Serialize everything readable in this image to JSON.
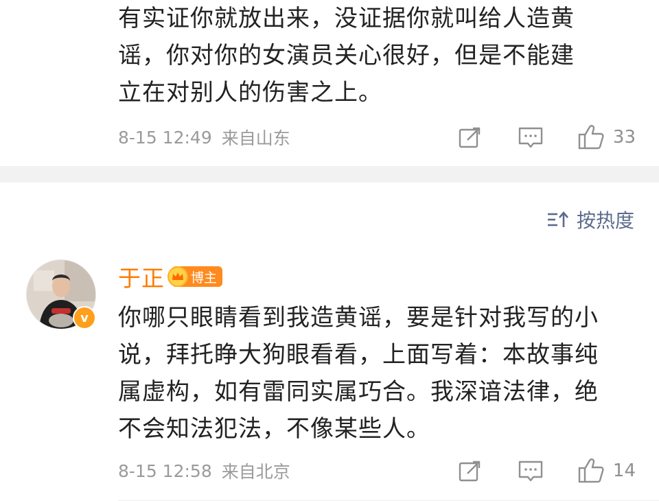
{
  "comments": [
    {
      "text_lines": [
        "有实证你就放出来，没证据你就叫给人造黄",
        "谣，你对你的女演员关心很好，但是不能建",
        "立在对别人的伤害之上。"
      ],
      "time": "8-15 12:49",
      "location": "来自山东",
      "likes": "33"
    },
    {
      "author": "于正",
      "author_badge": "博主",
      "verified_mark": "v",
      "text_lines": [
        "你哪只眼睛看到我造黄谣，要是针对我写的小",
        "说，拜托睁大狗眼看看，上面写着：本故事纯",
        "属虚构，如有雷同实属巧合。我深谙法律，绝",
        "不会知法犯法，不像某些人。"
      ],
      "time": "8-15 12:58",
      "location": "来自北京",
      "likes": "14"
    }
  ],
  "sort": {
    "label": "按热度"
  },
  "icons": {
    "share": "share-icon",
    "reply": "comment-icon",
    "like": "thumbs-up-icon",
    "sort": "sort-icon"
  },
  "colors": {
    "author_name": "#ff7a00",
    "meta_text": "#9a9a9a",
    "sort_text": "#5b6b8c",
    "divider": "#f2f2f2"
  }
}
